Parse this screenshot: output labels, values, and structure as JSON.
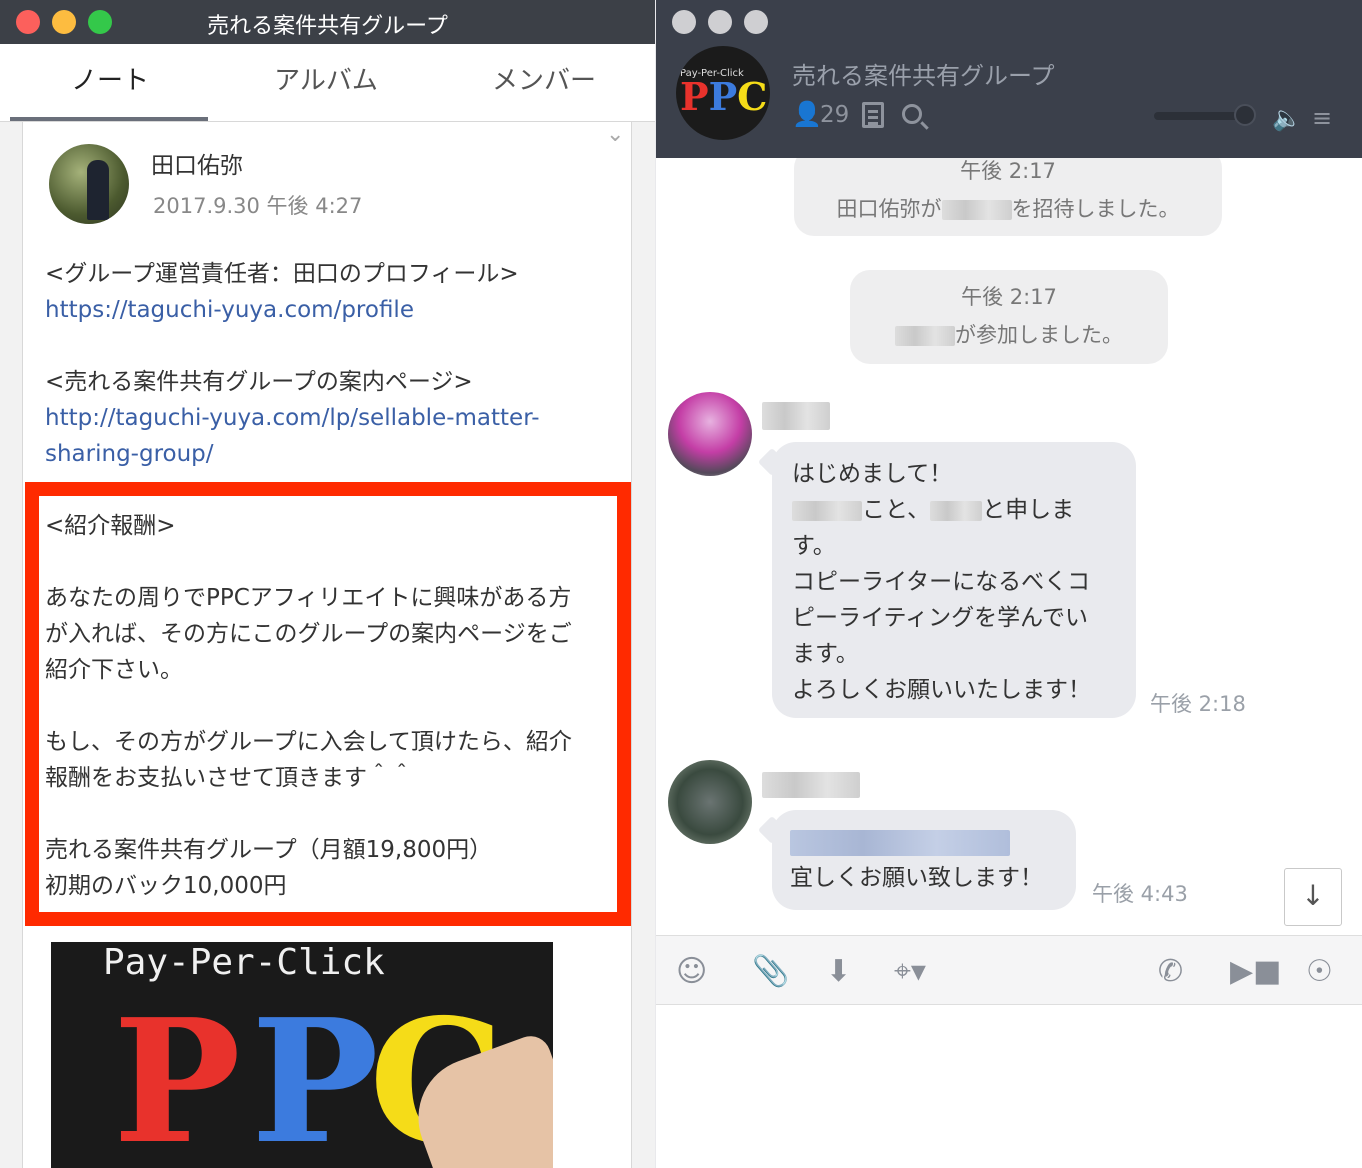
{
  "left_window": {
    "title": "売れる案件共有グループ",
    "tabs": [
      "ノート",
      "アルバム",
      "メンバー"
    ],
    "chevron": "⌄",
    "post": {
      "author": "田口佑弥",
      "date": "2017.9.30 午後 4:27",
      "profile_heading": "<グループ運営責任者：田口のプロフィール>",
      "profile_link": "https://taguchi-yuya.com/profile",
      "lp_heading": "<売れる案件共有グループの案内ページ>",
      "lp_link_1": "http://taguchi-yuya.com/lp/sellable-matter-",
      "lp_link_2": "sharing-group/",
      "referral_heading": "<紹介報酬>",
      "referral_p1_1": "あなたの周りでPPCアフィリエイトに興味がある方",
      "referral_p1_2": "が入れば、その方にこのグループの案内ページをご",
      "referral_p1_3": "紹介下さい。",
      "referral_p2_1": "もし、その方がグループに入会して頂けたら、紹介",
      "referral_p2_2": "報酬をお支払いさせて頂きます＾＾",
      "referral_p3_1": "売れる案件共有グループ（月額19,800円）",
      "referral_p3_2": "初期のバック10,000円"
    },
    "image": {
      "subtitle": "Pay-Per-Click",
      "p1": "P",
      "p2": "P",
      "c": "C"
    }
  },
  "right_window": {
    "group_name": "売れる案件共有グループ",
    "member_count": "29",
    "avatar_sub": "Pay-Per-Click",
    "avatar_p": "P",
    "avatar_p2": "P",
    "avatar_c": "C",
    "system_messages": [
      {
        "time": "午後 2:17",
        "prefix": "田口佑弥が",
        "suffix": "を招待しました。"
      },
      {
        "time": "午後 2:17",
        "suffix": "が参加しました。"
      }
    ],
    "messages": [
      {
        "line1": "はじめまして！",
        "line2_a": "こと、",
        "line2_b": "と申しま",
        "line3": "す。",
        "line4": "コピーライターになるべくコ",
        "line5": "ピーライティングを学んでい",
        "line6": "ます。",
        "line7": "よろしくお願いいたします！",
        "time": "午後 2:18"
      },
      {
        "line2": "宜しくお願い致します！",
        "time": "午後 4:43"
      }
    ],
    "scroll_down": "↓"
  },
  "icons": {
    "member": "person-icon",
    "note": "note-icon",
    "search": "search-icon",
    "speaker": "speaker-icon",
    "menu": "menu-icon",
    "emoji": "emoji-icon",
    "clip": "paperclip-icon",
    "download": "download-icon",
    "crop": "crop-icon",
    "phone": "phone-icon",
    "video": "video-icon",
    "live": "live-icon"
  },
  "colors": {
    "highlight": "#ff2a00",
    "link": "#3a5fa6",
    "header_dark": "#3b404b"
  }
}
